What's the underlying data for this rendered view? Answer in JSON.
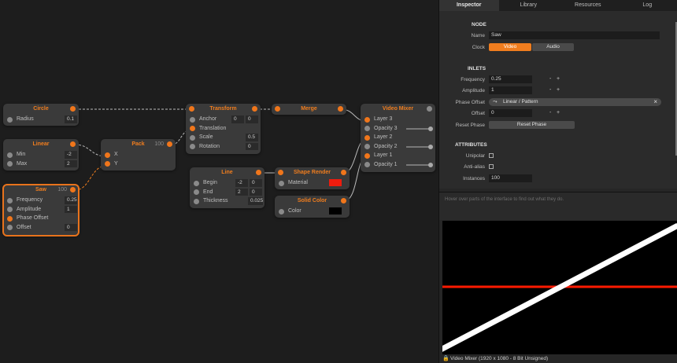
{
  "nodes": {
    "circle": {
      "title": "Circle",
      "params": [
        {
          "label": "Radius",
          "value": "0.1"
        }
      ]
    },
    "linear": {
      "title": "Linear",
      "params": [
        {
          "label": "Min",
          "value": "-2"
        },
        {
          "label": "Max",
          "value": "2"
        }
      ]
    },
    "saw": {
      "title": "Saw",
      "count": "100",
      "params": [
        {
          "label": "Frequency",
          "value": "0.25"
        },
        {
          "label": "Amplitude",
          "value": "1"
        },
        {
          "label": "Phase Offset",
          "value": ""
        },
        {
          "label": "Offset",
          "value": "0"
        }
      ]
    },
    "pack": {
      "title": "Pack",
      "count": "100",
      "params": [
        {
          "label": "X"
        },
        {
          "label": "Y"
        }
      ]
    },
    "transform": {
      "title": "Transform",
      "params": [
        {
          "label": "Anchor",
          "v1": "0",
          "v2": "0"
        },
        {
          "label": "Translation"
        },
        {
          "label": "Scale",
          "value": "0.5"
        },
        {
          "label": "Rotation",
          "value": "0"
        }
      ]
    },
    "line": {
      "title": "Line",
      "params": [
        {
          "label": "Begin",
          "v1": "-2",
          "v2": "0"
        },
        {
          "label": "End",
          "v1": "2",
          "v2": "0"
        },
        {
          "label": "Thickness",
          "value": "0.025"
        }
      ]
    },
    "merge": {
      "title": "Merge"
    },
    "shape_render": {
      "title": "Shape Render",
      "params": [
        {
          "label": "Material"
        }
      ]
    },
    "solid_color": {
      "title": "Solid Color",
      "params": [
        {
          "label": "Color"
        }
      ]
    },
    "video_mixer": {
      "title": "Video Mixer",
      "params": [
        {
          "label": "Layer 3"
        },
        {
          "label": "Opacity 3"
        },
        {
          "label": "Layer 2"
        },
        {
          "label": "Opacity 2"
        },
        {
          "label": "Layer 1"
        },
        {
          "label": "Opacity 1"
        }
      ]
    }
  },
  "tabs": [
    "Inspector",
    "Library",
    "Resources",
    "Log"
  ],
  "inspector": {
    "node_header": "NODE",
    "name_label": "Name",
    "name_value": "Saw",
    "clock_label": "Clock",
    "clock_options": [
      "Video",
      "Audio"
    ],
    "inlets_header": "INLETS",
    "frequency_label": "Frequency",
    "frequency_value": "0.25",
    "amplitude_label": "Amplitude",
    "amplitude_value": "1",
    "phase_offset_label": "Phase Offset",
    "phase_offset_value": "Linear / Pattern",
    "offset_label": "Offset",
    "offset_value": "0",
    "reset_phase_label": "Reset Phase",
    "reset_phase_button": "Reset Phase",
    "attributes_header": "ATTRIBUTES",
    "unipolar_label": "Unipolar",
    "antialias_label": "Anti-alias",
    "instances_label": "Instances",
    "instances_value": "100",
    "minus": "-",
    "plus": "+",
    "close": "×"
  },
  "hint": "Hover over parts of the interface to find out what they do.",
  "status": "Video Mixer (1920 x 1080 - 8 Bit Unsigned)",
  "colors": {
    "accent": "#f07d1e",
    "material": "#ee1c0e",
    "solid_color": "#000000",
    "line_red": "#ff1a00",
    "line_white": "#ffffff"
  }
}
